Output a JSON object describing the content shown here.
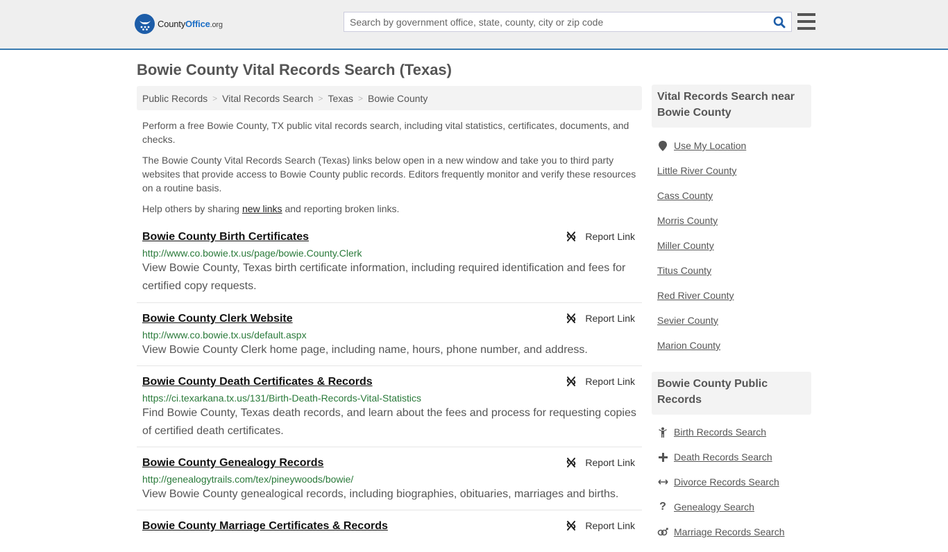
{
  "header": {
    "logo": {
      "county": "County",
      "office": "Office",
      "org": ".org"
    },
    "search_placeholder": "Search by government office, state, county, city or zip code",
    "search_value": "",
    "brand_color": "#1d5da8",
    "accent_border_color": "#3a7bb0"
  },
  "page_title": "Bowie County Vital Records Search (Texas)",
  "breadcrumb": [
    {
      "label": "Public Records"
    },
    {
      "label": "Vital Records Search"
    },
    {
      "label": "Texas"
    },
    {
      "label": "Bowie County"
    }
  ],
  "intro": {
    "p1": "Perform a free Bowie County, TX public vital records search, including vital statistics, certificates, documents, and checks.",
    "p2": "The Bowie County Vital Records Search (Texas) links below open in a new window and take you to third party websites that provide access to Bowie County public records. Editors frequently monitor and verify these resources on a routine basis.",
    "p3_before": "Help others by sharing ",
    "p3_link": "new links",
    "p3_after": " and reporting broken links."
  },
  "report_label": "Report Link",
  "results": [
    {
      "title": "Bowie County Birth Certificates",
      "url": "http://www.co.bowie.tx.us/page/bowie.County.Clerk",
      "desc": "View Bowie County, Texas birth certificate information, including required identification and fees for certified copy requests."
    },
    {
      "title": "Bowie County Clerk Website",
      "url": "http://www.co.bowie.tx.us/default.aspx",
      "desc": "View Bowie County Clerk home page, including name, hours, phone number, and address."
    },
    {
      "title": "Bowie County Death Certificates & Records",
      "url": "https://ci.texarkana.tx.us/131/Birth-Death-Records-Vital-Statistics",
      "desc": "Find Bowie County, Texas death records, and learn about the fees and process for requesting copies of certified death certificates."
    },
    {
      "title": "Bowie County Genealogy Records",
      "url": "http://genealogytrails.com/tex/pineywoods/bowie/",
      "desc": "View Bowie County genealogical records, including biographies, obituaries, marriages and births."
    },
    {
      "title": "Bowie County Marriage Certificates & Records",
      "url": "",
      "desc": ""
    }
  ],
  "sidebar": {
    "nearby_heading": "Vital Records Search near Bowie County",
    "use_location": "Use My Location",
    "nearby": [
      "Little River County",
      "Cass County",
      "Morris County",
      "Miller County",
      "Titus County",
      "Red River County",
      "Sevier County",
      "Marion County"
    ],
    "public_heading": "Bowie County Public Records",
    "public_records": [
      {
        "label": "Birth Records Search",
        "icon": "child-icon"
      },
      {
        "label": "Death Records Search",
        "icon": "plus-icon"
      },
      {
        "label": "Divorce Records Search",
        "icon": "arrows-horizontal-icon"
      },
      {
        "label": "Genealogy Search",
        "icon": "question-icon"
      },
      {
        "label": "Marriage Records Search",
        "icon": "marriage-icon"
      }
    ]
  }
}
